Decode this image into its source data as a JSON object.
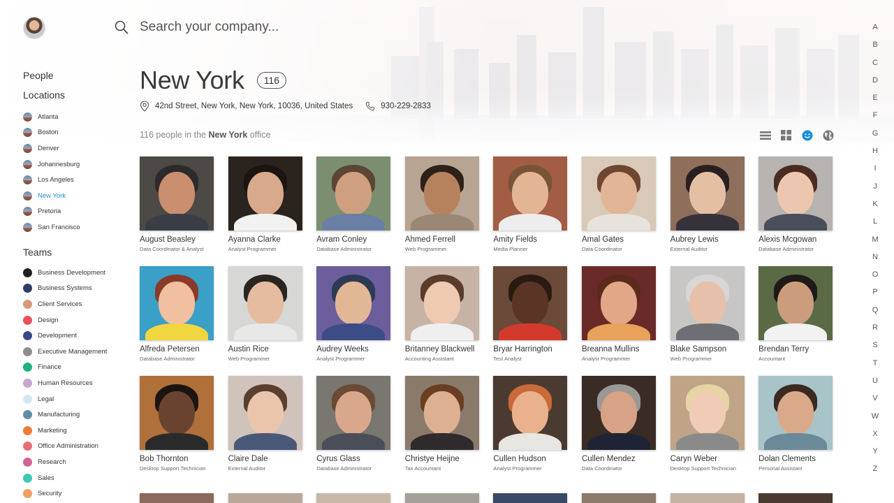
{
  "search": {
    "placeholder": "Search your company..."
  },
  "nav": {
    "people": "People",
    "locations": "Locations"
  },
  "locations": [
    {
      "label": "Atlanta",
      "active": false
    },
    {
      "label": "Boston",
      "active": false
    },
    {
      "label": "Denver",
      "active": false
    },
    {
      "label": "Johannesburg",
      "active": false
    },
    {
      "label": "Los Angeles",
      "active": false
    },
    {
      "label": "New York",
      "active": true
    },
    {
      "label": "Pretoria",
      "active": false
    },
    {
      "label": "San Francisco",
      "active": false
    }
  ],
  "teams_heading": "Teams",
  "teams": [
    {
      "label": "Business Development",
      "color": "#1f1f24"
    },
    {
      "label": "Business Systems",
      "color": "#2f3c66"
    },
    {
      "label": "Client Services",
      "color": "#d89a7a"
    },
    {
      "label": "Design",
      "color": "#ec4f5e"
    },
    {
      "label": "Development",
      "color": "#3a4a86"
    },
    {
      "label": "Executive Management",
      "color": "#8d8d8d"
    },
    {
      "label": "Finance",
      "color": "#1fb07a"
    },
    {
      "label": "Human Resources",
      "color": "#c9a6cf"
    },
    {
      "label": "Legal",
      "color": "#d7e6f4"
    },
    {
      "label": "Manufacturing",
      "color": "#5e8ea8"
    },
    {
      "label": "Marketing",
      "color": "#ee7a3a"
    },
    {
      "label": "Office Administration",
      "color": "#ea6c74"
    },
    {
      "label": "Research",
      "color": "#d36494"
    },
    {
      "label": "Sales",
      "color": "#3fc7b4"
    },
    {
      "label": "Security",
      "color": "#f0a05e"
    }
  ],
  "header": {
    "title": "New York",
    "count": "116",
    "address": "42nd Street, New York, New York, 10036, United States",
    "phone": "930-229-2833",
    "subtitle_prefix": "116 people in the ",
    "subtitle_location": "New York",
    "subtitle_suffix": " office"
  },
  "view_toggles": [
    "list-view",
    "grid-view",
    "face-view",
    "map-view"
  ],
  "accent_color": "#1a8fd9",
  "people": [
    {
      "name": "August Beasley",
      "role": "Data Coordinator & Analyst",
      "bg": "#4d4a45",
      "skin": "#c98f6e",
      "hair": "#2c2a2a",
      "shirt": "#3b3d46"
    },
    {
      "name": "Ayanna Clarke",
      "role": "Analyst Programmer",
      "bg": "#2a231e",
      "skin": "#d8a98a",
      "hair": "#1c1411",
      "shirt": "#f2f2f2"
    },
    {
      "name": "Avram Conley",
      "role": "Database Administrator",
      "bg": "#7b8f70",
      "skin": "#cfa080",
      "hair": "#5b4533",
      "shirt": "#6a7fa6"
    },
    {
      "name": "Ahmed Ferrell",
      "role": "Web Programmer",
      "bg": "#b8a493",
      "skin": "#b6825d",
      "hair": "#2d2118",
      "shirt": "#9a8774"
    },
    {
      "name": "Amity Fields",
      "role": "Media Planner",
      "bg": "#a25d44",
      "skin": "#e3b594",
      "hair": "#7a5238",
      "shirt": "#ededed"
    },
    {
      "name": "Amal Gates",
      "role": "Data Coordinator",
      "bg": "#d8c9b8",
      "skin": "#e2b596",
      "hair": "#6e4730",
      "shirt": "#e8e2dc"
    },
    {
      "name": "Aubrey Lewis",
      "role": "External Auditor",
      "bg": "#8d6f5c",
      "skin": "#e5bfa4",
      "hair": "#2a1f1f",
      "shirt": "#35323b"
    },
    {
      "name": "Alexis Mcgowan",
      "role": "Database Administrator",
      "bg": "#b6b3b0",
      "skin": "#ecc6ae",
      "hair": "#4a2b22",
      "shirt": "#4a4e5a"
    },
    {
      "name": "Alfreda Petersen",
      "role": "Database Administrator",
      "bg": "#3aa0c8",
      "skin": "#f0c0a0",
      "hair": "#8a3a2a",
      "shirt": "#f2d640"
    },
    {
      "name": "Austin Rice",
      "role": "Web Programmer",
      "bg": "#d7d7d5",
      "skin": "#e5bca0",
      "hair": "#2b2522",
      "shirt": "#e8e8e6"
    },
    {
      "name": "Audrey Weeks",
      "role": "Analyst Programmer",
      "bg": "#6c5d9c",
      "skin": "#e2b796",
      "hair": "#2d3a55",
      "shirt": "#3c4c86"
    },
    {
      "name": "Britanney Blackwell",
      "role": "Accounting Assistant",
      "bg": "#c7b3a6",
      "skin": "#efcab0",
      "hair": "#5a3b2c",
      "shirt": "#efefef"
    },
    {
      "name": "Bryar Harrington",
      "role": "Test Analyst",
      "bg": "#6b4a3a",
      "skin": "#5a3424",
      "hair": "#2a1a12",
      "shirt": "#d33a2c"
    },
    {
      "name": "Breanna Mullins",
      "role": "Analyst Programmer",
      "bg": "#6a2a28",
      "skin": "#e0a886",
      "hair": "#5a2a1c",
      "shirt": "#e8a25a"
    },
    {
      "name": "Blake Sampson",
      "role": "Web Programmer",
      "bg": "#c8c6c5",
      "skin": "#e7c0aa",
      "hair": "#d8d6d4",
      "shirt": "#6d6f74"
    },
    {
      "name": "Brendan Terry",
      "role": "Accountant",
      "bg": "#5a6a44",
      "skin": "#cc9d7c",
      "hair": "#1e1a18",
      "shirt": "#f2f2f2"
    },
    {
      "name": "Bob Thornton",
      "role": "Desktop Support Technician",
      "bg": "#b0703a",
      "skin": "#6a4330",
      "hair": "#1c1410",
      "shirt": "#2a2a2a"
    },
    {
      "name": "Claire Dale",
      "role": "External Auditor",
      "bg": "#cfc3bb",
      "skin": "#eac5ac",
      "hair": "#5a3e2e",
      "shirt": "#4a5878"
    },
    {
      "name": "Cyrus Glass",
      "role": "Database Administrator",
      "bg": "#7a7670",
      "skin": "#d9a88c",
      "hair": "#6a4a34",
      "shirt": "#4a4e58"
    },
    {
      "name": "Christye Heijne",
      "role": "Tax Accountant",
      "bg": "#8a7a6a",
      "skin": "#ddb092",
      "hair": "#6a3e22",
      "shirt": "#2f2a2c"
    },
    {
      "name": "Cullen Hudson",
      "role": "Analyst Programmer",
      "bg": "#4a3a30",
      "skin": "#e9b28c",
      "hair": "#c86a3a",
      "shirt": "#e8e6e2"
    },
    {
      "name": "Cullen Mendez",
      "role": "Data Coordinator",
      "bg": "#3a2c24",
      "skin": "#d8a286",
      "hair": "#9a9896",
      "shirt": "#1e2436"
    },
    {
      "name": "Caryn Weber",
      "role": "Desktop Support Technician",
      "bg": "#bfa488",
      "skin": "#f0ccb4",
      "hair": "#e6d4a4",
      "shirt": "#8a8a8a"
    },
    {
      "name": "Dolan Clements",
      "role": "Personal Assistant",
      "bg": "#a8c4c8",
      "skin": "#d9a98a",
      "hair": "#3a2a22",
      "shirt": "#6a8a9a"
    }
  ],
  "partial_row_colors": [
    "#8a6a5a",
    "#b9a89a",
    "#c8b8a8",
    "#a5a09a",
    "#3a4a66",
    "#8c7a6a",
    "#c4b2a2",
    "#4a3a30"
  ],
  "alpha": [
    "A",
    "B",
    "C",
    "D",
    "E",
    "F",
    "G",
    "H",
    "I",
    "J",
    "K",
    "L",
    "M",
    "N",
    "O",
    "P",
    "Q",
    "R",
    "S",
    "T",
    "U",
    "V",
    "W",
    "X",
    "Y",
    "Z"
  ]
}
